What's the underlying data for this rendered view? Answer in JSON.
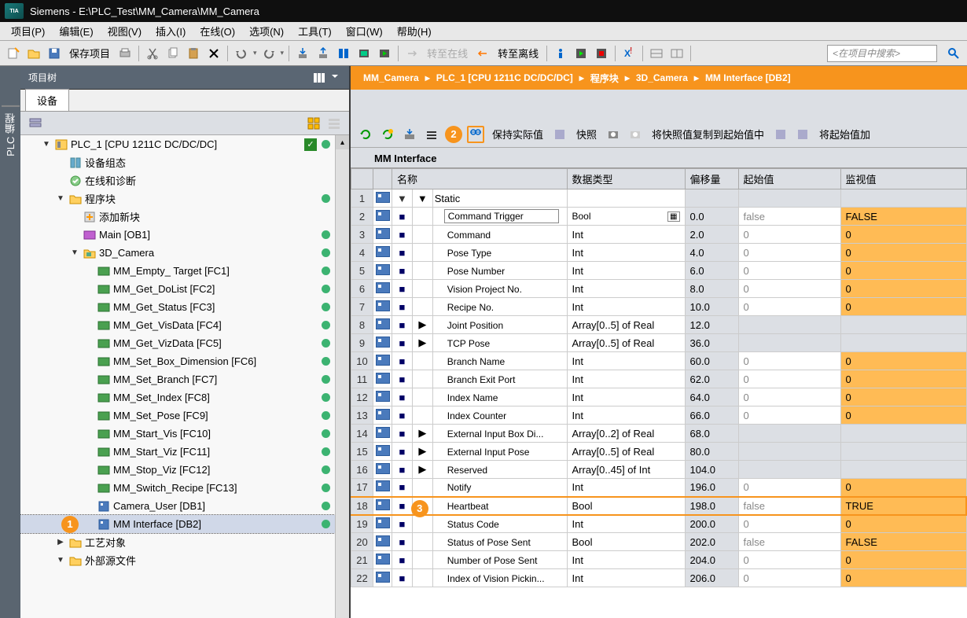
{
  "title": "Siemens  -  E:\\PLC_Test\\MM_Camera\\MM_Camera",
  "menus": [
    "项目(P)",
    "编辑(E)",
    "视图(V)",
    "插入(I)",
    "在线(O)",
    "选项(N)",
    "工具(T)",
    "窗口(W)",
    "帮助(H)"
  ],
  "toolbar": {
    "save_label": "保存项目",
    "go_online": "转至在线",
    "go_offline": "转至离线",
    "search_placeholder": "<在项目中搜索>"
  },
  "left_vertical_tab": "PLC 编程",
  "project_tree": {
    "title": "项目树",
    "tab": "设备",
    "nodes": [
      {
        "indent": 1,
        "toggle": "▼",
        "icon": "plc",
        "label": "PLC_1 [CPU 1211C DC/DC/DC]",
        "check": true,
        "dot": true
      },
      {
        "indent": 2,
        "toggle": "",
        "icon": "device",
        "label": "设备组态"
      },
      {
        "indent": 2,
        "toggle": "",
        "icon": "diag",
        "label": "在线和诊断"
      },
      {
        "indent": 2,
        "toggle": "▼",
        "icon": "folder-prog",
        "label": "程序块",
        "dot": true
      },
      {
        "indent": 3,
        "toggle": "",
        "icon": "add",
        "label": "添加新块"
      },
      {
        "indent": 3,
        "toggle": "",
        "icon": "ob",
        "label": "Main [OB1]",
        "dot": true
      },
      {
        "indent": 3,
        "toggle": "▼",
        "icon": "folder-cam",
        "label": "3D_Camera",
        "dot": true
      },
      {
        "indent": 4,
        "toggle": "",
        "icon": "fc",
        "label": "MM_Empty_ Target [FC1]",
        "dot": true
      },
      {
        "indent": 4,
        "toggle": "",
        "icon": "fc",
        "label": "MM_Get_DoList [FC2]",
        "dot": true
      },
      {
        "indent": 4,
        "toggle": "",
        "icon": "fc",
        "label": "MM_Get_Status [FC3]",
        "dot": true
      },
      {
        "indent": 4,
        "toggle": "",
        "icon": "fc",
        "label": "MM_Get_VisData [FC4]",
        "dot": true
      },
      {
        "indent": 4,
        "toggle": "",
        "icon": "fc",
        "label": "MM_Get_VizData [FC5]",
        "dot": true
      },
      {
        "indent": 4,
        "toggle": "",
        "icon": "fc",
        "label": "MM_Set_Box_Dimension [FC6]",
        "dot": true
      },
      {
        "indent": 4,
        "toggle": "",
        "icon": "fc",
        "label": "MM_Set_Branch [FC7]",
        "dot": true
      },
      {
        "indent": 4,
        "toggle": "",
        "icon": "fc",
        "label": "MM_Set_Index [FC8]",
        "dot": true
      },
      {
        "indent": 4,
        "toggle": "",
        "icon": "fc",
        "label": "MM_Set_Pose [FC9]",
        "dot": true
      },
      {
        "indent": 4,
        "toggle": "",
        "icon": "fc",
        "label": "MM_Start_Vis [FC10]",
        "dot": true
      },
      {
        "indent": 4,
        "toggle": "",
        "icon": "fc",
        "label": "MM_Start_Viz [FC11]",
        "dot": true
      },
      {
        "indent": 4,
        "toggle": "",
        "icon": "fc",
        "label": "MM_Stop_Viz [FC12]",
        "dot": true
      },
      {
        "indent": 4,
        "toggle": "",
        "icon": "fc",
        "label": "MM_Switch_Recipe [FC13]",
        "dot": true
      },
      {
        "indent": 4,
        "toggle": "",
        "icon": "db",
        "label": "Camera_User [DB1]",
        "dot": true
      },
      {
        "indent": 4,
        "toggle": "",
        "icon": "db",
        "label": "MM Interface [DB2]",
        "dot": true,
        "selected": true,
        "badge": "1"
      },
      {
        "indent": 2,
        "toggle": "▶",
        "icon": "folder",
        "label": "工艺对象"
      },
      {
        "indent": 2,
        "toggle": "▼",
        "icon": "folder",
        "label": "外部源文件"
      }
    ]
  },
  "breadcrumb": [
    "MM_Camera",
    "PLC_1 [CPU 1211C DC/DC/DC]",
    "程序块",
    "3D_Camera",
    "MM Interface [DB2]"
  ],
  "right_tb": {
    "badge2": "2",
    "keep_actual": "保持实际值",
    "snapshot": "快照",
    "copy_snap": "将快照值复制到起始值中",
    "copy_start": "将起始值加"
  },
  "db": {
    "title": "MM Interface",
    "cols": [
      "名称",
      "数据类型",
      "偏移量",
      "起始值",
      "监视值"
    ],
    "rows": [
      {
        "n": 1,
        "exp": "▼",
        "name": "Static",
        "type": "",
        "offset": "",
        "start": "",
        "mon": ""
      },
      {
        "n": 2,
        "exp": "",
        "name": "Command Trigger",
        "input": true,
        "type": "Bool",
        "typeicon": true,
        "offset": "0.0",
        "start": "false",
        "greystart": true,
        "mon": "FALSE",
        "monfill": true
      },
      {
        "n": 3,
        "exp": "",
        "name": "Command",
        "type": "Int",
        "offset": "2.0",
        "start": "0",
        "greystart": true,
        "mon": "0",
        "monfill": true
      },
      {
        "n": 4,
        "exp": "",
        "name": "Pose Type",
        "type": "Int",
        "offset": "4.0",
        "start": "0",
        "greystart": true,
        "mon": "0",
        "monfill": true
      },
      {
        "n": 5,
        "exp": "",
        "name": "Pose Number",
        "type": "Int",
        "offset": "6.0",
        "start": "0",
        "greystart": true,
        "mon": "0",
        "monfill": true
      },
      {
        "n": 6,
        "exp": "",
        "name": "Vision Project No.",
        "type": "Int",
        "offset": "8.0",
        "start": "0",
        "greystart": true,
        "mon": "0",
        "monfill": true
      },
      {
        "n": 7,
        "exp": "",
        "name": "Recipe No.",
        "type": "Int",
        "offset": "10.0",
        "start": "0",
        "greystart": true,
        "mon": "0",
        "monfill": true
      },
      {
        "n": 8,
        "exp": "▶",
        "name": "Joint Position",
        "type": "Array[0..5] of Real",
        "offset": "12.0",
        "start": "",
        "mon": ""
      },
      {
        "n": 9,
        "exp": "▶",
        "name": "TCP Pose",
        "type": "Array[0..5] of Real",
        "offset": "36.0",
        "start": "",
        "mon": ""
      },
      {
        "n": 10,
        "exp": "",
        "name": "Branch Name",
        "type": "Int",
        "offset": "60.0",
        "start": "0",
        "greystart": true,
        "mon": "0",
        "monfill": true
      },
      {
        "n": 11,
        "exp": "",
        "name": "Branch Exit Port",
        "type": "Int",
        "offset": "62.0",
        "start": "0",
        "greystart": true,
        "mon": "0",
        "monfill": true
      },
      {
        "n": 12,
        "exp": "",
        "name": "Index Name",
        "type": "Int",
        "offset": "64.0",
        "start": "0",
        "greystart": true,
        "mon": "0",
        "monfill": true
      },
      {
        "n": 13,
        "exp": "",
        "name": "Index Counter",
        "type": "Int",
        "offset": "66.0",
        "start": "0",
        "greystart": true,
        "mon": "0",
        "monfill": true
      },
      {
        "n": 14,
        "exp": "▶",
        "name": "External Input Box Di...",
        "type": "Array[0..2] of Real",
        "offset": "68.0",
        "start": "",
        "mon": ""
      },
      {
        "n": 15,
        "exp": "▶",
        "name": "External Input Pose",
        "type": "Array[0..5] of Real",
        "offset": "80.0",
        "start": "",
        "mon": ""
      },
      {
        "n": 16,
        "exp": "▶",
        "name": "Reserved",
        "type": "Array[0..45] of Int",
        "offset": "104.0",
        "start": "",
        "mon": ""
      },
      {
        "n": 17,
        "exp": "",
        "name": "Notify",
        "type": "Int",
        "offset": "196.0",
        "start": "0",
        "greystart": true,
        "mon": "0",
        "monfill": true
      },
      {
        "n": 18,
        "exp": "",
        "name": "Heartbeat",
        "type": "Bool",
        "offset": "198.0",
        "start": "false",
        "greystart": true,
        "mon": "TRUE",
        "monfill": true,
        "badge": "3",
        "hot": true
      },
      {
        "n": 19,
        "exp": "",
        "name": "Status Code",
        "type": "Int",
        "offset": "200.0",
        "start": "0",
        "greystart": true,
        "mon": "0",
        "monfill": true
      },
      {
        "n": 20,
        "exp": "",
        "name": "Status of Pose Sent",
        "type": "Bool",
        "offset": "202.0",
        "start": "false",
        "greystart": true,
        "mon": "FALSE",
        "monfill": true
      },
      {
        "n": 21,
        "exp": "",
        "name": "Number of Pose Sent",
        "type": "Int",
        "offset": "204.0",
        "start": "0",
        "greystart": true,
        "mon": "0",
        "monfill": true
      },
      {
        "n": 22,
        "exp": "",
        "name": "Index of Vision Pickin...",
        "type": "Int",
        "offset": "206.0",
        "start": "0",
        "greystart": true,
        "mon": "0",
        "monfill": true
      }
    ]
  }
}
